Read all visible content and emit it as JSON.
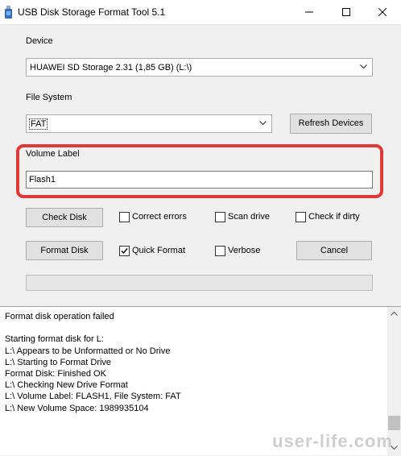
{
  "window": {
    "title": "USB Disk Storage Format Tool 5.1",
    "icons": [
      "usb-drive-icon",
      "minimize-icon",
      "maximize-icon",
      "close-icon"
    ]
  },
  "device": {
    "label": "Device",
    "selected": "HUAWEI  SD Storage  2.31 (1,85 GB) (L:\\)"
  },
  "file_system": {
    "label": "File System",
    "selected": "FAT",
    "refresh_label": "Refresh Devices"
  },
  "volume": {
    "label": "Volume Label",
    "value": "Flash1"
  },
  "actions": {
    "check_disk": "Check Disk",
    "format_disk": "Format Disk",
    "cancel": "Cancel"
  },
  "options": {
    "correct_errors": {
      "label": "Correct errors",
      "checked": false
    },
    "scan_drive": {
      "label": "Scan drive",
      "checked": false
    },
    "check_if_dirty": {
      "label": "Check if dirty",
      "checked": false
    },
    "quick_format": {
      "label": "Quick Format",
      "checked": true
    },
    "verbose": {
      "label": "Verbose",
      "checked": false
    }
  },
  "progress": {
    "fraction": 0
  },
  "log": {
    "lines": [
      "Format disk operation failed",
      "",
      "Starting format disk for L:",
      "L:\\ Appears to be Unformatted or No Drive",
      "L:\\ Starting to Format Drive",
      "Format Disk: Finished OK",
      "L:\\ Checking New Drive Format",
      "L:\\ Volume Label: FLASH1, File System: FAT",
      "L:\\ New Volume Space: 1989935104"
    ]
  },
  "watermark": "user-life.com",
  "colors": {
    "highlight": "#e03a36",
    "background": "#f0f0f0"
  }
}
